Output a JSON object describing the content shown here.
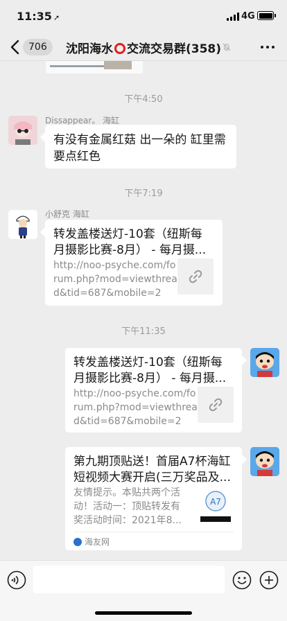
{
  "status_bar": {
    "time": "11:35",
    "location_glyph": "➚",
    "network": "4G"
  },
  "nav": {
    "unread_count": "706",
    "title_before": "沈阳海水",
    "title_after": "交流交易群(358)"
  },
  "messages": {
    "divider_1": "下午4:50",
    "msg1": {
      "sender": "Dissappear。 海缸",
      "text_line1": "有没有金属红菇 出一朵的 缸里需",
      "text_line2": "要点红色"
    },
    "divider_2": "下午7:19",
    "msg2": {
      "sender": "小舒克 海缸",
      "title_line1": "转发盖楼送灯-10套（纽斯每",
      "title_line2": "月摄影比赛-8月） - 每月摄...",
      "url_line1": "http://noo-psyche.com/fo",
      "url_line2": "rum.php?mod=viewthrea",
      "url_line3": "d&tid=687&mobile=2"
    },
    "divider_3": "下午11:35",
    "msg3": {
      "title_line1": "转发盖楼送灯-10套（纽斯每",
      "title_line2": "月摄影比赛-8月） - 每月摄...",
      "url_line1": "http://noo-psyche.com/fo",
      "url_line2": "rum.php?mod=viewthrea",
      "url_line3": "d&tid=687&mobile=2"
    },
    "msg4": {
      "title_line1": "第九期顶贴送！首届A7杯海缸",
      "title_line2": "短视频大赛开启(三万奖品及...",
      "desc_line1": "友情提示。本贴共两个活",
      "desc_line2": "动！活动一：顶贴转发有",
      "desc_line3": "奖活动时间：2021年8...",
      "source": "海友网"
    }
  },
  "input": {
    "placeholder": ""
  }
}
